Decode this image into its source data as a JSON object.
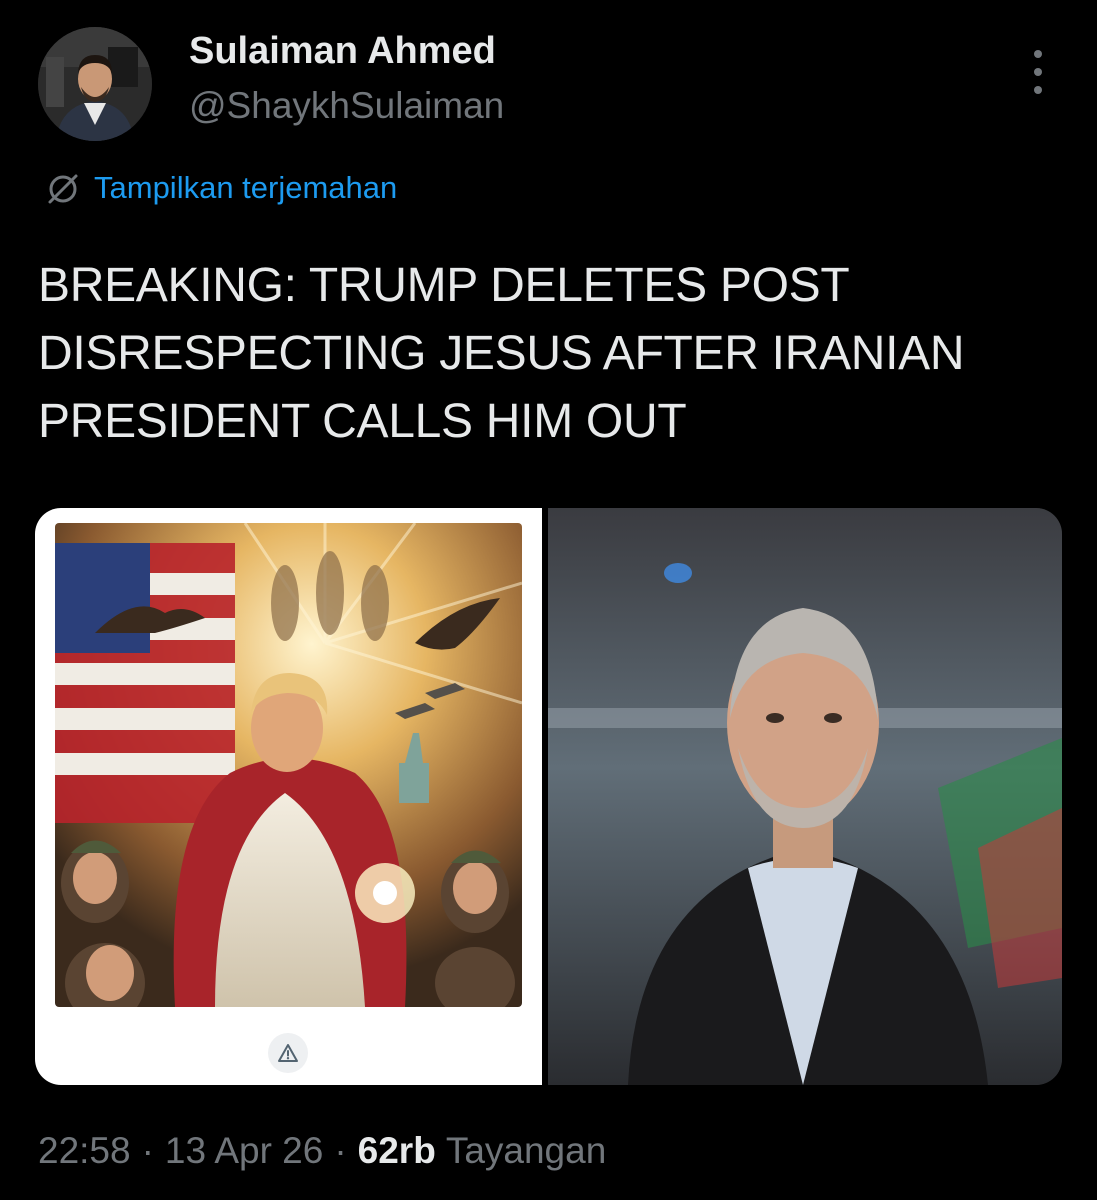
{
  "author": {
    "name": "Sulaiman Ahmed",
    "handle": "@ShaykhSulaiman"
  },
  "translate": {
    "label": "Tampilkan terjemahan",
    "icon": "globe-slash-icon"
  },
  "tweet": {
    "text": "BREAKING: TRUMP DELETES POST\nDISRESPECTING JESUS AFTER IRANIAN\nPRESIDENT CALLS HIM OUT"
  },
  "media": {
    "left_icon": "warning-icon",
    "right_icon": "photo"
  },
  "meta": {
    "time": "22:58",
    "date": "13 Apr 26",
    "separator": "·",
    "views_count": "62rb",
    "views_label": "Tayangan"
  },
  "colors": {
    "background": "#000000",
    "text_primary": "#e7e9ea",
    "text_secondary": "#71767b",
    "link": "#1d9bf0"
  }
}
